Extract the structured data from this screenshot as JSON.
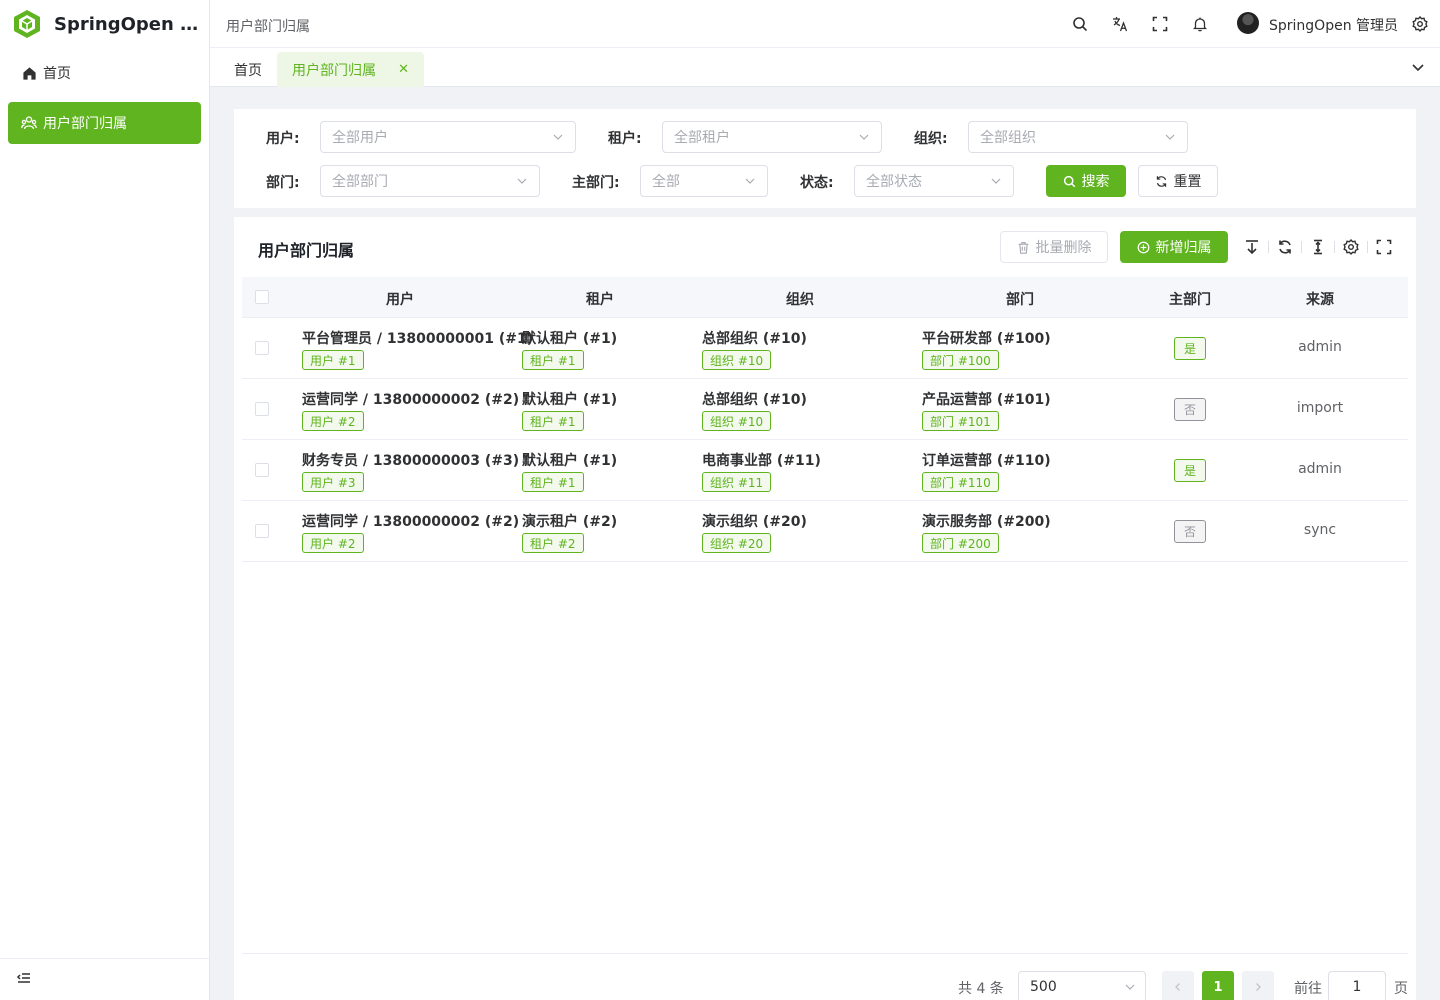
{
  "app": {
    "title": "SpringOpen Ad..."
  },
  "sidebar": {
    "items": [
      {
        "label": "首页",
        "icon": "home-icon"
      },
      {
        "label": "用户部门归属",
        "icon": "users-icon",
        "active": true
      }
    ]
  },
  "header": {
    "breadcrumb": "用户部门归属",
    "user_name": "SpringOpen 管理员"
  },
  "tabs": [
    {
      "label": "首页"
    },
    {
      "label": "用户部门归属",
      "active": true,
      "close": "✕"
    }
  ],
  "filters": {
    "user": {
      "label": "用户:",
      "placeholder": "全部用户"
    },
    "tenant": {
      "label": "租户:",
      "placeholder": "全部租户"
    },
    "org": {
      "label": "组织:",
      "placeholder": "全部组织"
    },
    "dept": {
      "label": "部门:",
      "placeholder": "全部部门"
    },
    "main_dept": {
      "label": "主部门:",
      "placeholder": "全部"
    },
    "status": {
      "label": "状态:",
      "placeholder": "全部状态"
    },
    "search_label": "搜索",
    "reset_label": "重置"
  },
  "table": {
    "title": "用户部门归属",
    "batch_delete_label": "批量删除",
    "add_label": "新增归属",
    "columns": [
      "用户",
      "租户",
      "组织",
      "部门",
      "主部门",
      "来源"
    ],
    "rows": [
      {
        "user": "平台管理员 / 13800000001 (#1)",
        "user_tag": "用户 #1",
        "tenant": "默认租户 (#1)",
        "tenant_tag": "租户 #1",
        "org": "总部组织 (#10)",
        "org_tag": "组织 #10",
        "dept": "平台研发部 (#100)",
        "dept_tag": "部门 #100",
        "main": "是",
        "main_flag": true,
        "source": "admin"
      },
      {
        "user": "运营同学 / 13800000002 (#2)",
        "user_tag": "用户 #2",
        "tenant": "默认租户 (#1)",
        "tenant_tag": "租户 #1",
        "org": "总部组织 (#10)",
        "org_tag": "组织 #10",
        "dept": "产品运营部 (#101)",
        "dept_tag": "部门 #101",
        "main": "否",
        "main_flag": false,
        "source": "import"
      },
      {
        "user": "财务专员 / 13800000003 (#3)",
        "user_tag": "用户 #3",
        "tenant": "默认租户 (#1)",
        "tenant_tag": "租户 #1",
        "org": "电商事业部 (#11)",
        "org_tag": "组织 #11",
        "dept": "订单运营部 (#110)",
        "dept_tag": "部门 #110",
        "main": "是",
        "main_flag": true,
        "source": "admin"
      },
      {
        "user": "运营同学 / 13800000002 (#2)",
        "user_tag": "用户 #2",
        "tenant": "演示租户 (#2)",
        "tenant_tag": "租户 #2",
        "org": "演示组织 (#20)",
        "org_tag": "组织 #20",
        "dept": "演示服务部 (#200)",
        "dept_tag": "部门 #200",
        "main": "否",
        "main_flag": false,
        "source": "sync"
      }
    ]
  },
  "pagination": {
    "total_text": "共 4 条",
    "page_size": "500",
    "current_page": "1",
    "goto_label": "前往",
    "goto_value": "1",
    "page_suffix": "页"
  },
  "colors": {
    "primary": "#5fb41f",
    "tag_bg": "#f3faed",
    "muted": "#909399"
  }
}
